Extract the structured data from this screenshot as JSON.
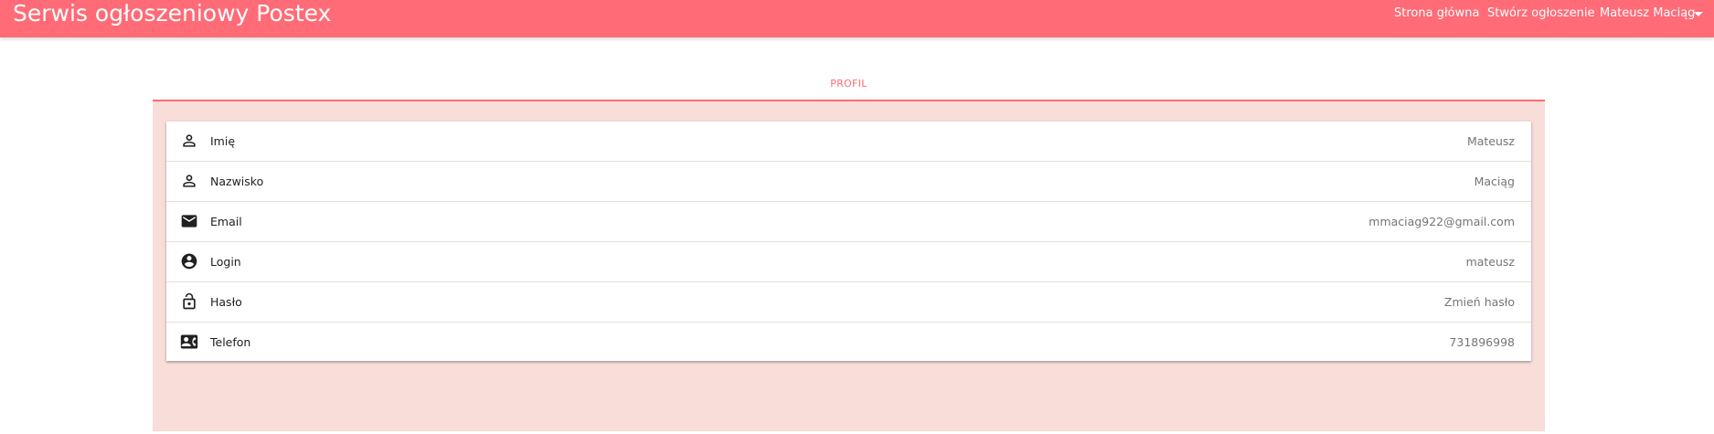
{
  "header": {
    "brand": "Serwis ogłoszeniowy Postex",
    "nav": {
      "home": "Strona główna",
      "create": "Stwórz ogłoszenie",
      "user": "Mateusz Maciąg"
    }
  },
  "tab": {
    "label": "PROFIL"
  },
  "profile": {
    "rows": [
      {
        "icon": "person-icon",
        "label": "Imię",
        "value": "Mateusz"
      },
      {
        "icon": "person-icon",
        "label": "Nazwisko",
        "value": "Maciąg"
      },
      {
        "icon": "email-icon",
        "label": "Email",
        "value": "mmaciag922@gmail.com"
      },
      {
        "icon": "account-circle-icon",
        "label": "Login",
        "value": "mateusz"
      },
      {
        "icon": "lock-icon",
        "label": "Hasło",
        "value": "Zmień hasło"
      },
      {
        "icon": "contact-card-icon",
        "label": "Telefon",
        "value": "731896998"
      }
    ]
  },
  "colors": {
    "primary": "#ff6b76",
    "panel_background": "#f8ddd8",
    "text": "#212121",
    "secondary_text": "#757575"
  }
}
